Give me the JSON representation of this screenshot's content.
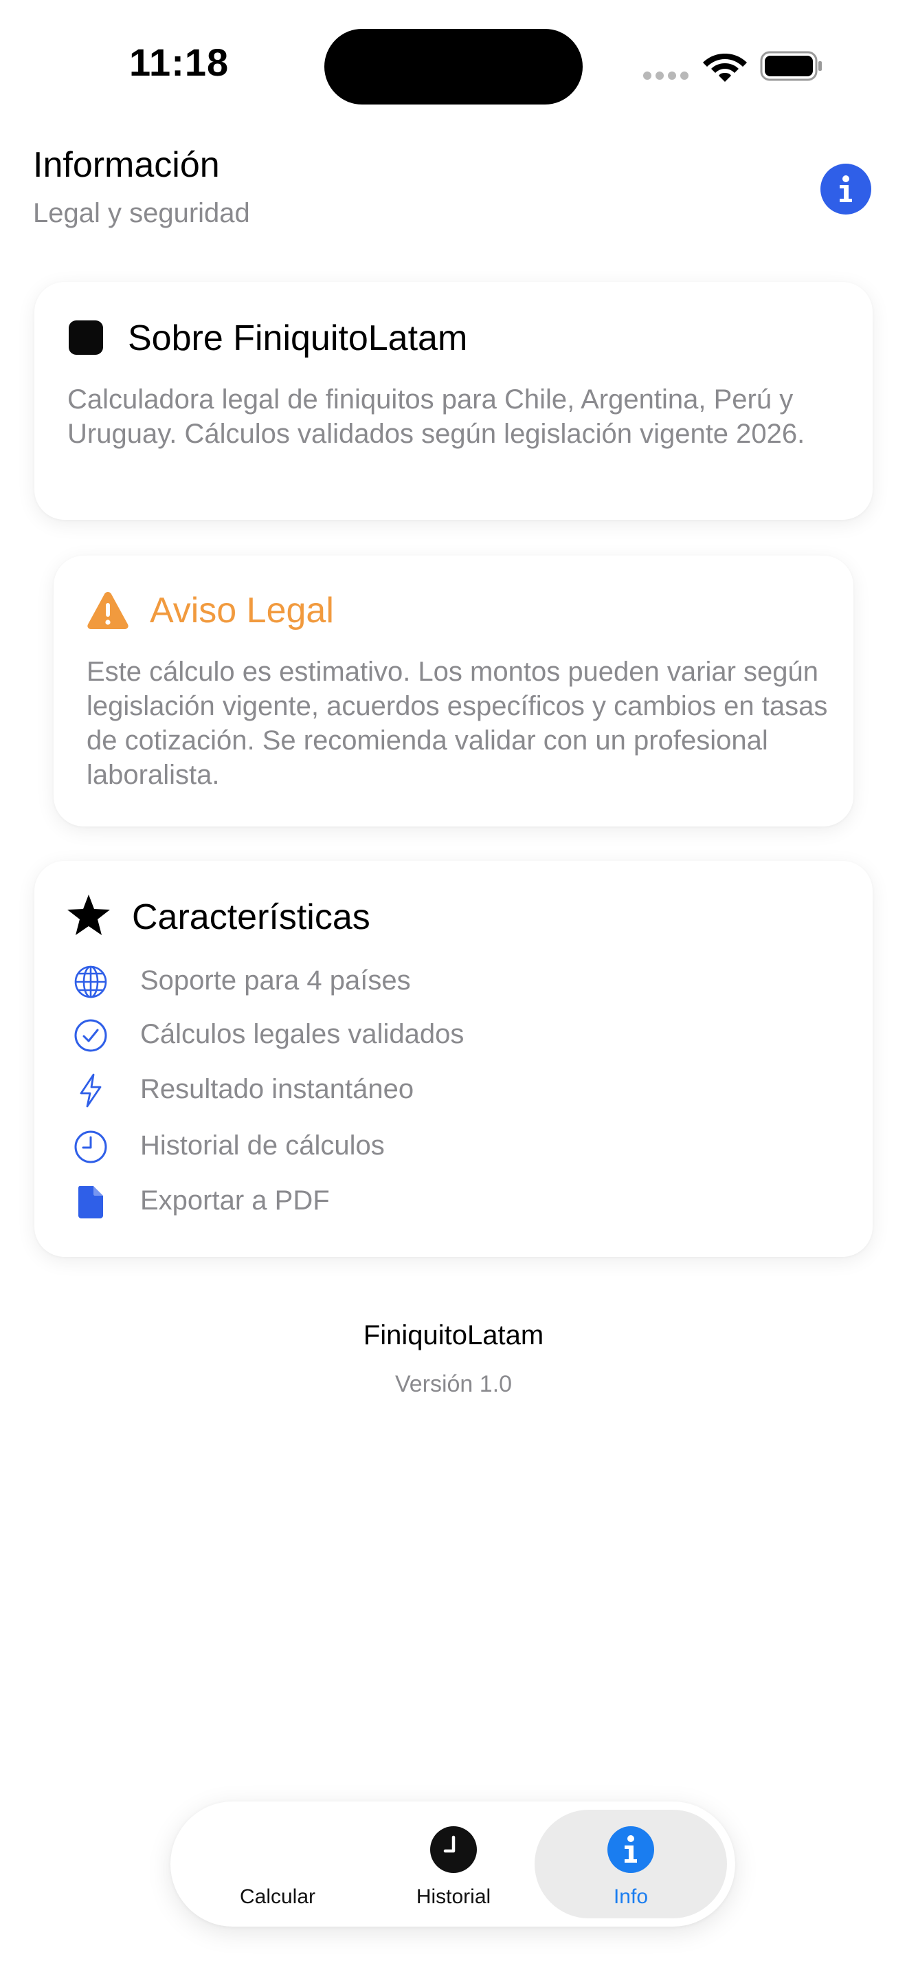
{
  "status_bar": {
    "time": "11:18"
  },
  "header": {
    "title": "Información",
    "subtitle": "Legal y seguridad",
    "info_icon": "info-circle-icon"
  },
  "about_card": {
    "icon": "square-app-icon",
    "title": "Sobre FiniquitoLatam",
    "body": "Calculadora legal de finiquitos para Chile, Argentina, Perú y Uruguay. Cálculos validados según legislación vigente 2026."
  },
  "legal_card": {
    "icon": "warning-triangle-icon",
    "title": "Aviso Legal",
    "body": "Este cálculo es estimativo. Los montos pueden variar según legislación vigente, acuerdos específicos y cambios en tasas de cotización. Se recomienda validar con un profesional laboralista.",
    "accent_color": "#f19a3e"
  },
  "features_card": {
    "icon": "star-icon",
    "title": "Características",
    "items": [
      {
        "icon": "globe-icon",
        "label": "Soporte para 4 países"
      },
      {
        "icon": "checkmark-circle-icon",
        "label": "Cálculos legales validados"
      },
      {
        "icon": "bolt-icon",
        "label": "Resultado instantáneo"
      },
      {
        "icon": "clock-icon",
        "label": "Historial de cálculos"
      },
      {
        "icon": "document-icon",
        "label": "Exportar a PDF"
      }
    ],
    "icon_color": "#2f5fe8"
  },
  "footer": {
    "app_name": "FiniquitoLatam",
    "version": "Versión 1.0"
  },
  "tab_bar": {
    "tabs": [
      {
        "label": "Calcular",
        "icon": "none",
        "selected": false
      },
      {
        "label": "Historial",
        "icon": "clock-icon",
        "selected": false
      },
      {
        "label": "Info",
        "icon": "info-circle-icon",
        "selected": true
      }
    ],
    "selected_color": "#1a7df0"
  }
}
